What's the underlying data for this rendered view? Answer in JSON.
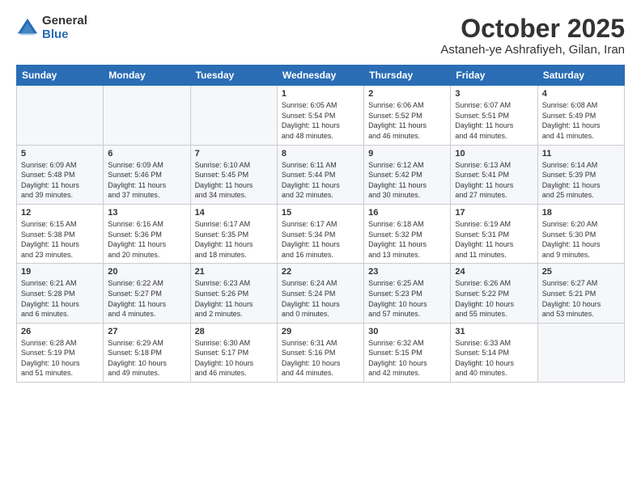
{
  "logo": {
    "general": "General",
    "blue": "Blue"
  },
  "header": {
    "month": "October 2025",
    "location": "Astaneh-ye Ashrafiyeh, Gilan, Iran"
  },
  "days_of_week": [
    "Sunday",
    "Monday",
    "Tuesday",
    "Wednesday",
    "Thursday",
    "Friday",
    "Saturday"
  ],
  "weeks": [
    {
      "days": [
        {
          "num": "",
          "info": ""
        },
        {
          "num": "",
          "info": ""
        },
        {
          "num": "",
          "info": ""
        },
        {
          "num": "1",
          "info": "Sunrise: 6:05 AM\nSunset: 5:54 PM\nDaylight: 11 hours\nand 48 minutes."
        },
        {
          "num": "2",
          "info": "Sunrise: 6:06 AM\nSunset: 5:52 PM\nDaylight: 11 hours\nand 46 minutes."
        },
        {
          "num": "3",
          "info": "Sunrise: 6:07 AM\nSunset: 5:51 PM\nDaylight: 11 hours\nand 44 minutes."
        },
        {
          "num": "4",
          "info": "Sunrise: 6:08 AM\nSunset: 5:49 PM\nDaylight: 11 hours\nand 41 minutes."
        }
      ]
    },
    {
      "days": [
        {
          "num": "5",
          "info": "Sunrise: 6:09 AM\nSunset: 5:48 PM\nDaylight: 11 hours\nand 39 minutes."
        },
        {
          "num": "6",
          "info": "Sunrise: 6:09 AM\nSunset: 5:46 PM\nDaylight: 11 hours\nand 37 minutes."
        },
        {
          "num": "7",
          "info": "Sunrise: 6:10 AM\nSunset: 5:45 PM\nDaylight: 11 hours\nand 34 minutes."
        },
        {
          "num": "8",
          "info": "Sunrise: 6:11 AM\nSunset: 5:44 PM\nDaylight: 11 hours\nand 32 minutes."
        },
        {
          "num": "9",
          "info": "Sunrise: 6:12 AM\nSunset: 5:42 PM\nDaylight: 11 hours\nand 30 minutes."
        },
        {
          "num": "10",
          "info": "Sunrise: 6:13 AM\nSunset: 5:41 PM\nDaylight: 11 hours\nand 27 minutes."
        },
        {
          "num": "11",
          "info": "Sunrise: 6:14 AM\nSunset: 5:39 PM\nDaylight: 11 hours\nand 25 minutes."
        }
      ]
    },
    {
      "days": [
        {
          "num": "12",
          "info": "Sunrise: 6:15 AM\nSunset: 5:38 PM\nDaylight: 11 hours\nand 23 minutes."
        },
        {
          "num": "13",
          "info": "Sunrise: 6:16 AM\nSunset: 5:36 PM\nDaylight: 11 hours\nand 20 minutes."
        },
        {
          "num": "14",
          "info": "Sunrise: 6:17 AM\nSunset: 5:35 PM\nDaylight: 11 hours\nand 18 minutes."
        },
        {
          "num": "15",
          "info": "Sunrise: 6:17 AM\nSunset: 5:34 PM\nDaylight: 11 hours\nand 16 minutes."
        },
        {
          "num": "16",
          "info": "Sunrise: 6:18 AM\nSunset: 5:32 PM\nDaylight: 11 hours\nand 13 minutes."
        },
        {
          "num": "17",
          "info": "Sunrise: 6:19 AM\nSunset: 5:31 PM\nDaylight: 11 hours\nand 11 minutes."
        },
        {
          "num": "18",
          "info": "Sunrise: 6:20 AM\nSunset: 5:30 PM\nDaylight: 11 hours\nand 9 minutes."
        }
      ]
    },
    {
      "days": [
        {
          "num": "19",
          "info": "Sunrise: 6:21 AM\nSunset: 5:28 PM\nDaylight: 11 hours\nand 6 minutes."
        },
        {
          "num": "20",
          "info": "Sunrise: 6:22 AM\nSunset: 5:27 PM\nDaylight: 11 hours\nand 4 minutes."
        },
        {
          "num": "21",
          "info": "Sunrise: 6:23 AM\nSunset: 5:26 PM\nDaylight: 11 hours\nand 2 minutes."
        },
        {
          "num": "22",
          "info": "Sunrise: 6:24 AM\nSunset: 5:24 PM\nDaylight: 11 hours\nand 0 minutes."
        },
        {
          "num": "23",
          "info": "Sunrise: 6:25 AM\nSunset: 5:23 PM\nDaylight: 10 hours\nand 57 minutes."
        },
        {
          "num": "24",
          "info": "Sunrise: 6:26 AM\nSunset: 5:22 PM\nDaylight: 10 hours\nand 55 minutes."
        },
        {
          "num": "25",
          "info": "Sunrise: 6:27 AM\nSunset: 5:21 PM\nDaylight: 10 hours\nand 53 minutes."
        }
      ]
    },
    {
      "days": [
        {
          "num": "26",
          "info": "Sunrise: 6:28 AM\nSunset: 5:19 PM\nDaylight: 10 hours\nand 51 minutes."
        },
        {
          "num": "27",
          "info": "Sunrise: 6:29 AM\nSunset: 5:18 PM\nDaylight: 10 hours\nand 49 minutes."
        },
        {
          "num": "28",
          "info": "Sunrise: 6:30 AM\nSunset: 5:17 PM\nDaylight: 10 hours\nand 46 minutes."
        },
        {
          "num": "29",
          "info": "Sunrise: 6:31 AM\nSunset: 5:16 PM\nDaylight: 10 hours\nand 44 minutes."
        },
        {
          "num": "30",
          "info": "Sunrise: 6:32 AM\nSunset: 5:15 PM\nDaylight: 10 hours\nand 42 minutes."
        },
        {
          "num": "31",
          "info": "Sunrise: 6:33 AM\nSunset: 5:14 PM\nDaylight: 10 hours\nand 40 minutes."
        },
        {
          "num": "",
          "info": ""
        }
      ]
    }
  ]
}
